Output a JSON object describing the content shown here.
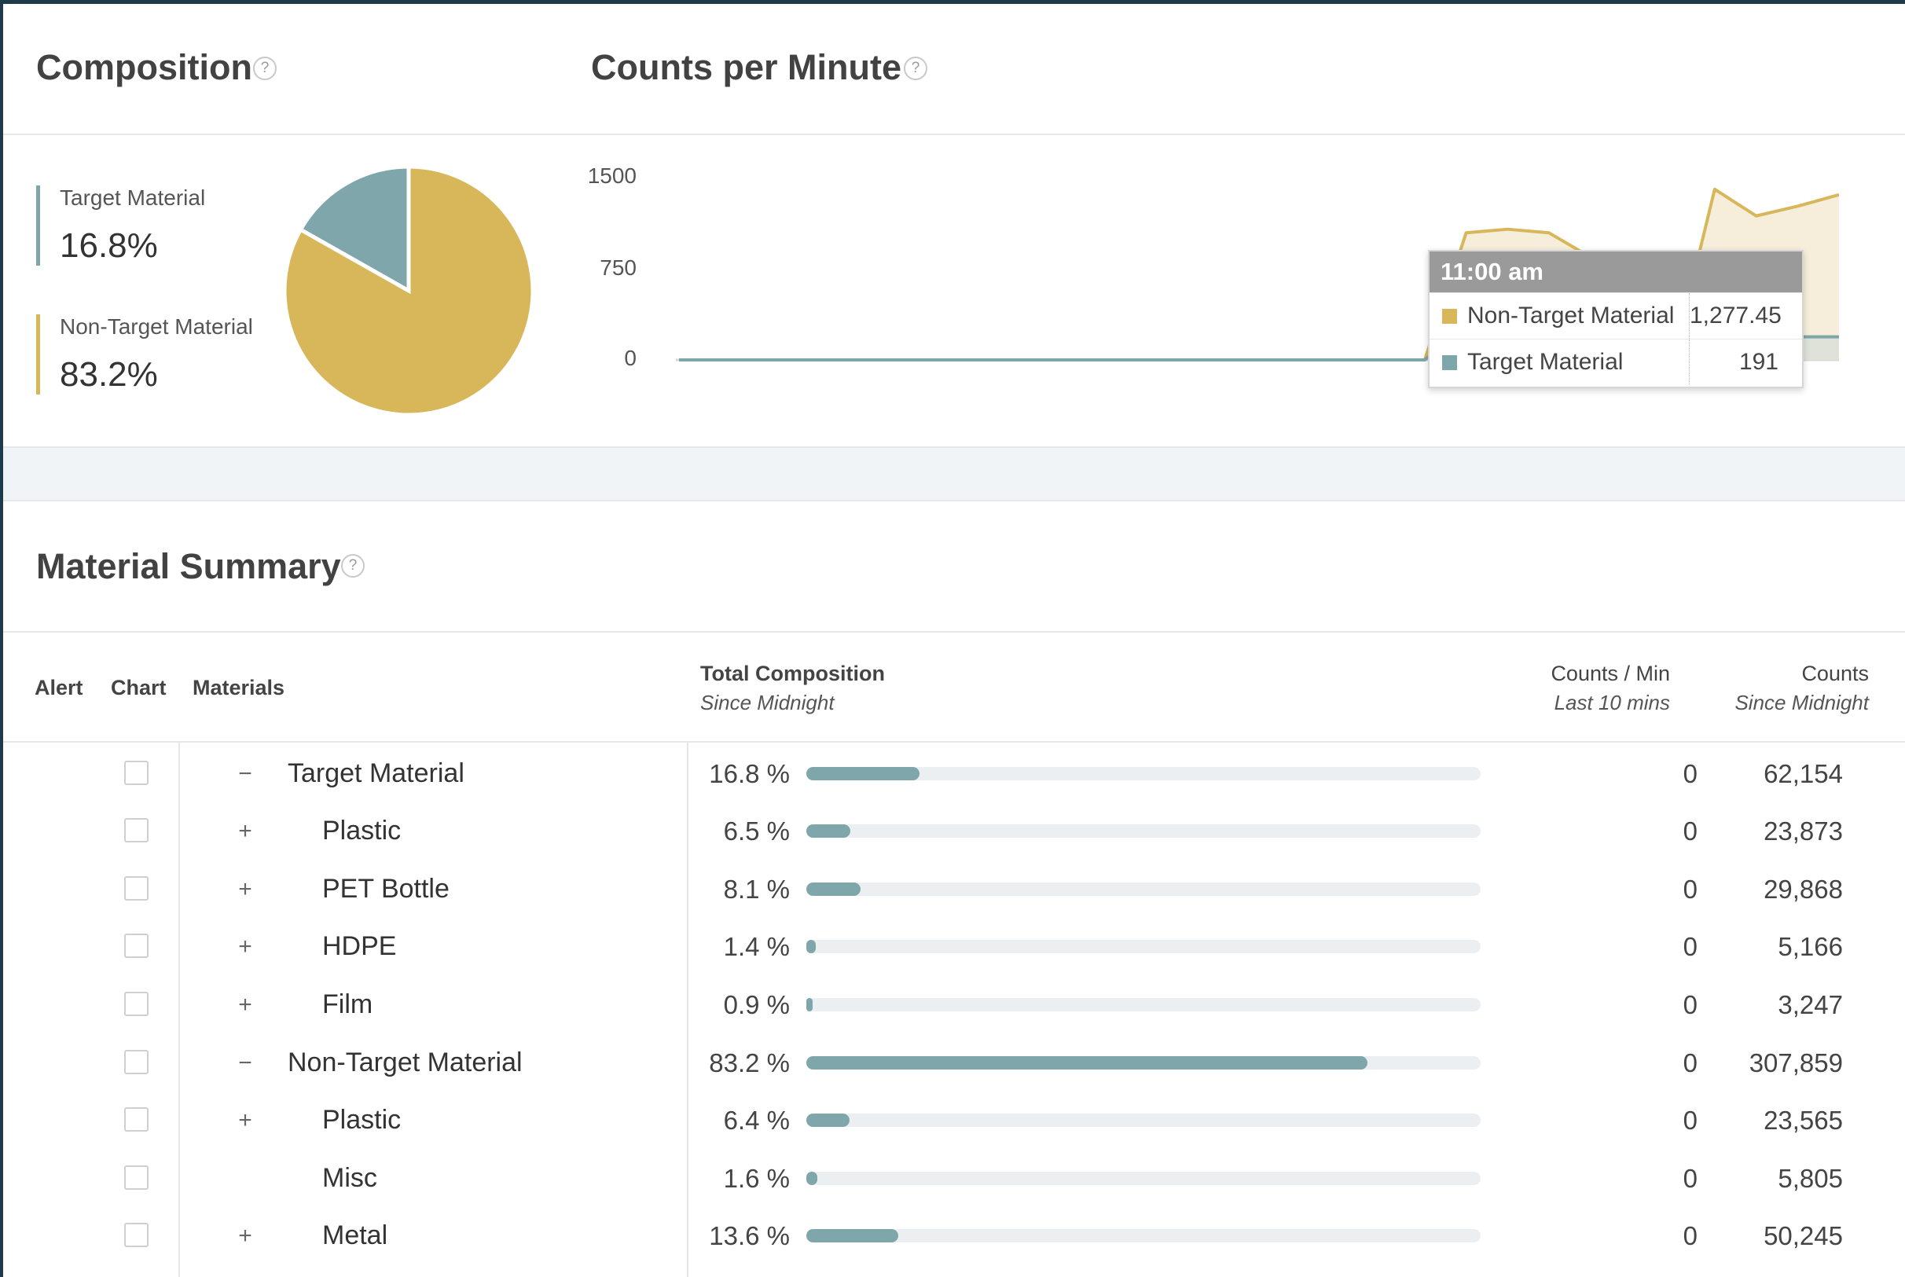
{
  "composition": {
    "title": "Composition",
    "help": "?",
    "items": [
      {
        "label": "Target Material",
        "value": "16.8%",
        "pct": 16.8,
        "color": "#7fa6ab"
      },
      {
        "label": "Non-Target Material",
        "value": "83.2%",
        "pct": 83.2,
        "color": "#d8b65a"
      }
    ]
  },
  "counts_per_minute": {
    "title": "Counts per Minute",
    "help": "?",
    "y_ticks": [
      "1500",
      "750",
      "0"
    ],
    "tooltip": {
      "time": "11:00 am",
      "rows": [
        {
          "name": "Non-Target Material",
          "value": "1,277.45",
          "color": "#d8b65a"
        },
        {
          "name": "Target Material",
          "value": "191",
          "color": "#7fa6ab"
        }
      ]
    }
  },
  "chart_data": {
    "type": "area",
    "ylim": [
      0,
      1500
    ],
    "yticks": [
      0,
      750,
      1500
    ],
    "x": [
      0,
      1,
      2,
      3,
      4,
      5,
      6,
      7,
      8,
      9,
      10,
      11,
      12,
      13,
      14,
      15,
      16,
      17,
      18,
      19,
      20,
      21,
      22,
      23,
      24,
      25,
      26,
      27,
      28
    ],
    "series": [
      {
        "name": "Non-Target Material",
        "color": "#d8b65a",
        "values": [
          0,
          0,
          0,
          0,
          0,
          0,
          0,
          0,
          0,
          0,
          0,
          0,
          0,
          0,
          0,
          0,
          0,
          0,
          0,
          1050,
          1080,
          1050,
          850,
          0,
          0,
          1410,
          1190,
          1270,
          1365
        ]
      },
      {
        "name": "Target Material",
        "color": "#7fa6ab",
        "values": [
          0,
          0,
          0,
          0,
          0,
          0,
          0,
          0,
          0,
          0,
          0,
          0,
          0,
          0,
          0,
          0,
          0,
          0,
          0,
          280,
          240,
          270,
          240,
          0,
          0,
          191,
          191,
          191,
          191
        ]
      }
    ]
  },
  "summary": {
    "title": "Material Summary",
    "help": "?",
    "headers": {
      "alert": "Alert",
      "chart": "Chart",
      "materials": "Materials",
      "total": "Total Composition",
      "total_sub": "Since Midnight",
      "cpm": "Counts / Min",
      "cpm_sub": "Last 10 mins",
      "counts": "Counts",
      "counts_sub": "Since Midnight"
    },
    "rows": [
      {
        "expander": "−",
        "name": "Target Material",
        "level": 0,
        "pct_label": "16.8 %",
        "pct": 16.8,
        "cpm": "0",
        "count": "62,154"
      },
      {
        "expander": "+",
        "name": "Plastic",
        "level": 1,
        "pct_label": "6.5 %",
        "pct": 6.5,
        "cpm": "0",
        "count": "23,873"
      },
      {
        "expander": "+",
        "name": "PET Bottle",
        "level": 1,
        "pct_label": "8.1 %",
        "pct": 8.1,
        "cpm": "0",
        "count": "29,868"
      },
      {
        "expander": "+",
        "name": "HDPE",
        "level": 1,
        "pct_label": "1.4 %",
        "pct": 1.4,
        "cpm": "0",
        "count": "5,166"
      },
      {
        "expander": "+",
        "name": "Film",
        "level": 1,
        "pct_label": "0.9 %",
        "pct": 0.9,
        "cpm": "0",
        "count": "3,247"
      },
      {
        "expander": "−",
        "name": "Non-Target Material",
        "level": 0,
        "pct_label": "83.2 %",
        "pct": 83.2,
        "cpm": "0",
        "count": "307,859"
      },
      {
        "expander": "+",
        "name": "Plastic",
        "level": 1,
        "pct_label": "6.4 %",
        "pct": 6.4,
        "cpm": "0",
        "count": "23,565"
      },
      {
        "expander": "",
        "name": "Misc",
        "level": 1,
        "pct_label": "1.6 %",
        "pct": 1.6,
        "cpm": "0",
        "count": "5,805"
      },
      {
        "expander": "+",
        "name": "Metal",
        "level": 1,
        "pct_label": "13.6 %",
        "pct": 13.6,
        "cpm": "0",
        "count": "50,245"
      }
    ]
  }
}
